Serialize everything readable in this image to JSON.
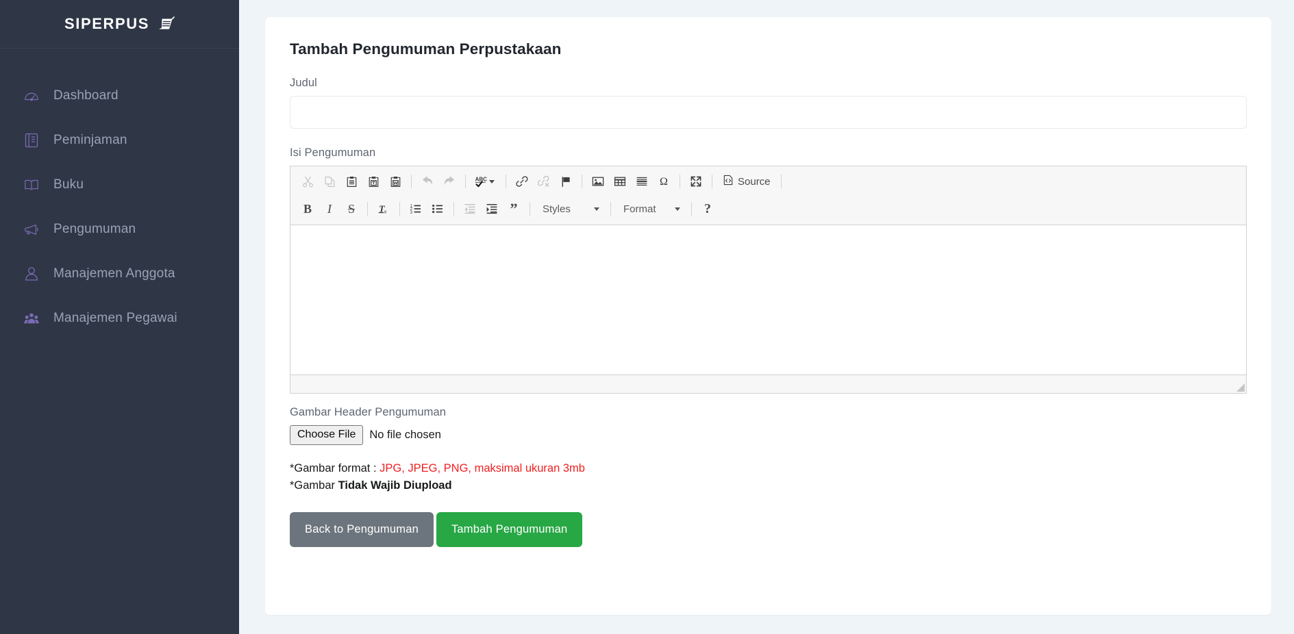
{
  "sidebar": {
    "brand": {
      "text": "SIPERPUS",
      "icon": "book-stack-icon"
    },
    "items": [
      {
        "label": "Dashboard",
        "icon": "speedometer-icon"
      },
      {
        "label": "Peminjaman",
        "icon": "notebook-icon"
      },
      {
        "label": "Buku",
        "icon": "open-book-icon"
      },
      {
        "label": "Pengumuman",
        "icon": "megaphone-icon"
      },
      {
        "label": "Manajemen Anggota",
        "icon": "user-icon"
      },
      {
        "label": "Manajemen Pegawai",
        "icon": "users-group-icon"
      }
    ]
  },
  "page": {
    "title": "Tambah Pengumuman Perpustakaan"
  },
  "form": {
    "judul": {
      "label": "Judul",
      "value": "",
      "placeholder": ""
    },
    "isi": {
      "label": "Isi Pengumuman",
      "value": ""
    },
    "gambar": {
      "label": "Gambar Header Pengumuman",
      "choose_label": "Choose File",
      "status": "No file chosen"
    },
    "notes": {
      "line1_prefix": "*Gambar format : ",
      "line1_highlight": "JPG, JPEG, PNG, maksimal ukuran 3mb",
      "line2_prefix": "*Gambar ",
      "line2_bold": "Tidak Wajib Diupload"
    },
    "actions": {
      "back_label": "Back to Pengumuman",
      "submit_label": "Tambah Pengumuman"
    }
  },
  "editor": {
    "toolbar_row1": [
      {
        "name": "cut-icon",
        "title": "Cut",
        "disabled": true
      },
      {
        "name": "copy-icon",
        "title": "Copy",
        "disabled": true
      },
      {
        "name": "paste-icon",
        "title": "Paste",
        "disabled": false
      },
      {
        "name": "paste-as-plain-text-icon",
        "title": "Paste as plain text",
        "disabled": false
      },
      {
        "name": "paste-from-word-icon",
        "title": "Paste from Word",
        "disabled": false
      },
      {
        "name": "undo-icon",
        "title": "Undo",
        "disabled": true
      },
      {
        "name": "redo-icon",
        "title": "Redo",
        "disabled": true
      },
      {
        "name": "spell-check-icon",
        "title": "Spell Check As You Type",
        "disabled": false
      },
      {
        "name": "link-icon",
        "title": "Link",
        "disabled": false
      },
      {
        "name": "unlink-icon",
        "title": "Unlink",
        "disabled": true
      },
      {
        "name": "anchor-flag-icon",
        "title": "Anchor",
        "disabled": false
      },
      {
        "name": "image-icon",
        "title": "Image",
        "disabled": false
      },
      {
        "name": "table-icon",
        "title": "Table",
        "disabled": false
      },
      {
        "name": "horizontal-rule-icon",
        "title": "Horizontal Line",
        "disabled": false
      },
      {
        "name": "special-character-icon",
        "title": "Insert Special Character",
        "disabled": false
      },
      {
        "name": "maximize-icon",
        "title": "Maximize",
        "disabled": false
      },
      {
        "name": "source-icon",
        "title": "Source",
        "disabled": false
      }
    ],
    "source_label": "Source",
    "toolbar_row2": [
      {
        "name": "bold-icon",
        "glyph": "B",
        "title": "Bold",
        "disabled": false
      },
      {
        "name": "italic-icon",
        "glyph": "I",
        "title": "Italic",
        "disabled": false
      },
      {
        "name": "strikethrough-icon",
        "glyph": "S",
        "title": "Strike Through",
        "disabled": false
      },
      {
        "name": "remove-format-icon",
        "glyph": "Tx",
        "title": "Remove Format",
        "disabled": false
      },
      {
        "name": "numbered-list-icon",
        "title": "Insert/Remove Numbered List",
        "disabled": false
      },
      {
        "name": "bulleted-list-icon",
        "title": "Insert/Remove Bulleted List",
        "disabled": false
      },
      {
        "name": "decrease-indent-icon",
        "title": "Decrease Indent",
        "disabled": true
      },
      {
        "name": "increase-indent-icon",
        "title": "Increase Indent",
        "disabled": false
      },
      {
        "name": "blockquote-icon",
        "glyph": "”",
        "title": "Block Quote",
        "disabled": false
      }
    ],
    "styles_combo": {
      "label": "Styles"
    },
    "format_combo": {
      "label": "Format"
    },
    "help_label": "?"
  },
  "colors": {
    "sidebar_bg": "#2f3646",
    "sidebar_icon": "#7c6bb5",
    "sidebar_text": "#9aa2b4",
    "page_bg": "#eef4f8",
    "card_bg": "#ffffff",
    "submit_green": "#28a745",
    "back_gray": "#6c757d",
    "note_red": "#ef2020",
    "toolbar_bg": "#f7f7f7"
  }
}
